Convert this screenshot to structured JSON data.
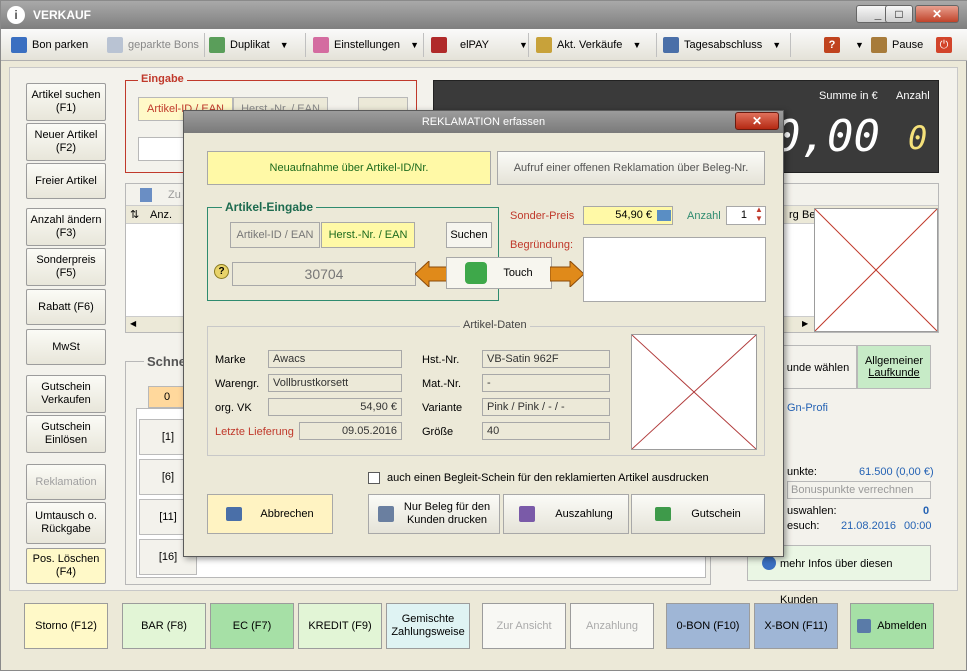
{
  "window": {
    "title": "VERKAUF",
    "min": "_",
    "max": "□",
    "close": "✕"
  },
  "toolbar": {
    "bon_parken": "Bon parken",
    "geparkte_bons": "geparkte Bons",
    "duplikat": "Duplikat",
    "einstellungen": "Einstellungen",
    "elpay": "elPAY",
    "akt_verkaeufe": "Akt. Verkäufe",
    "tagesabschluss": "Tagesabschluss",
    "pause": "Pause"
  },
  "left": [
    {
      "l1": "Artikel suchen",
      "l2": "(F1)"
    },
    {
      "l1": "Neuer Artikel",
      "l2": "(F2)"
    },
    {
      "l1": "Freier Artikel",
      "l2": ""
    },
    {
      "l1": "Anzahl ändern",
      "l2": "(F3)"
    },
    {
      "l1": "Sonderpreis",
      "l2": "(F5)"
    },
    {
      "l1": "Rabatt (F6)",
      "l2": ""
    },
    {
      "l1": "MwSt",
      "l2": ""
    },
    {
      "l1": "Gutschein",
      "l2": "Verkaufen"
    },
    {
      "l1": "Gutschein",
      "l2": "Einlösen"
    },
    {
      "l1": "Reklamation",
      "l2": ""
    },
    {
      "l1": "Umtausch o.",
      "l2": "Rückgabe"
    },
    {
      "l1": "Pos. Löschen",
      "l2": "(F4)"
    }
  ],
  "eingabe": {
    "legend": "Eingabe",
    "tab1": "Artikel-ID / EAN",
    "tab2": "Herst.-Nr. / EAN"
  },
  "summe": {
    "label": "Summe in €",
    "anzahl_label": "Anzahl",
    "value": "0,00",
    "count": "0"
  },
  "list": {
    "zu": "Zu",
    "col_anz": "Anz.",
    "col_rg": "rg",
    "col_be": "Be"
  },
  "schnell": {
    "title": "Schne",
    "tab": "0",
    "rows": [
      "[1]",
      "[6]",
      "[11]",
      "[16]"
    ]
  },
  "customer": {
    "kunde_waehlen": "unde wählen",
    "allgemeiner": "Allgemeiner",
    "laufkunde": "Laufkunde",
    "profile": "Gn-Profi",
    "punkte_label": "unkte:",
    "punkte_value": "61.500 (0,00 €)",
    "bonus_btn": "Bonuspunkte verrechnen",
    "auswahl_label": "uswahlen:",
    "auswahl_value": "0",
    "besuch_label": "esuch:",
    "besuch_date": "21.08.2016",
    "besuch_time": "00:00",
    "infos": "mehr Infos über diesen Kunden"
  },
  "bottom": {
    "storno": "Storno (F12)",
    "bar": "BAR (F8)",
    "ec": "EC (F7)",
    "kredit": "KREDIT (F9)",
    "gemischte1": "Gemischte",
    "gemischte2": "Zahlungsweise",
    "zur_ansicht": "Zur Ansicht",
    "anzahlung": "Anzahlung",
    "obon": "0-BON (F10)",
    "xbon": "X-BON (F11)",
    "abmelden": "Abmelden"
  },
  "dialog": {
    "title": "REKLAMATION erfassen",
    "close": "✕",
    "neuaufnahme": "Neuaufnahme über Artikel-ID/Nr.",
    "aufruf": "Aufruf einer offenen Reklamation über Beleg-Nr.",
    "artikel_eingabe": "Artikel-Eingabe",
    "tab_id": "Artikel-ID / EAN",
    "tab_herst": "Herst.-Nr. / EAN",
    "suchen": "Suchen",
    "input_value": "30704",
    "touch": "Touch",
    "sonderpreis_label": "Sonder-Preis",
    "sonderpreis_value": "54,90 €",
    "anzahl_label": "Anzahl",
    "anzahl_value": "1",
    "begruendung_label": "Begründung:",
    "artikel_daten": "Artikel-Daten",
    "marke_label": "Marke",
    "marke_value": "Awacs",
    "warengr_label": "Warengr.",
    "warengr_value": "Vollbrustkorsett",
    "orgvk_label": "org. VK",
    "orgvk_value": "54,90 €",
    "letzte_label": "Letzte Lieferung",
    "letzte_value": "09.05.2016",
    "hstnr_label": "Hst.-Nr.",
    "hstnr_value": "VB-Satin 962F",
    "matnr_label": "Mat.-Nr.",
    "matnr_value": "-",
    "variante_label": "Variante",
    "variante_value": "Pink / Pink / - / -",
    "groesse_label": "Größe",
    "groesse_value": "40",
    "checkbox_label": "auch einen Begleit-Schein für den reklamierten Artikel ausdrucken",
    "abbrechen": "Abbrechen",
    "nur_beleg1": "Nur Beleg für den",
    "nur_beleg2": "Kunden drucken",
    "auszahlung": "Auszahlung",
    "gutschein": "Gutschein"
  },
  "colors": {
    "accent_red": "#c0392b",
    "yellow": "#fff9c8",
    "green": "#a6e0a6",
    "blue": "#9fb6d6",
    "display_bg": "#3a3a3a"
  }
}
